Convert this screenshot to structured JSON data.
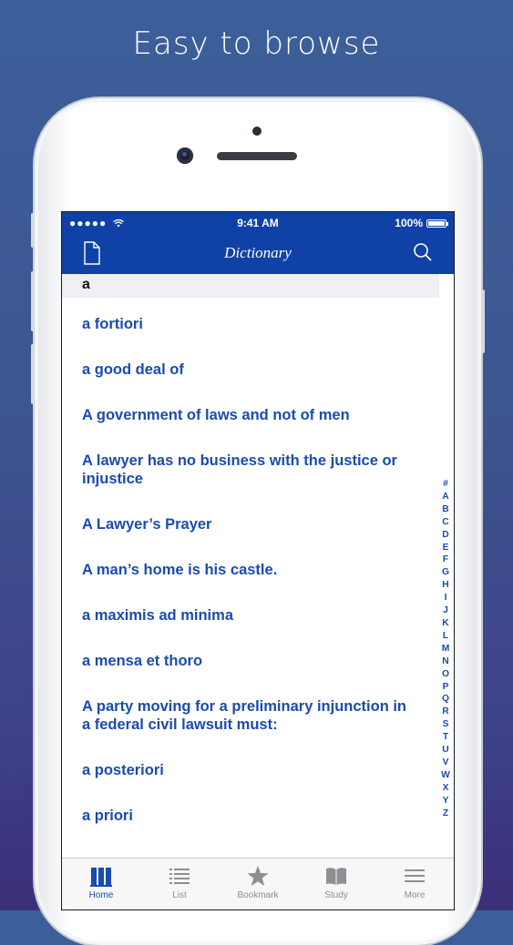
{
  "headline": "Easy to browse",
  "status_bar": {
    "signal": "●●●●●",
    "time": "9:41 AM",
    "battery": "100%"
  },
  "nav": {
    "title": "Dictionary",
    "left_icon": "document-icon",
    "right_icon": "search-icon"
  },
  "section_header": "a",
  "entries": [
    "a fortiori",
    "a good deal of",
    "A government of laws and not of men",
    "A lawyer has no business with the justice or injustice",
    "A Lawyer’s Prayer",
    "A man’s home is his castle.",
    "a maximis ad minima",
    "a mensa et thoro",
    "A party moving for a preliminary injunction in a federal civil lawsuit must:",
    "a posteriori",
    "a priori"
  ],
  "index_letters": [
    "#",
    "A",
    "B",
    "C",
    "D",
    "E",
    "F",
    "G",
    "H",
    "I",
    "J",
    "K",
    "L",
    "M",
    "N",
    "O",
    "P",
    "Q",
    "R",
    "S",
    "T",
    "U",
    "V",
    "W",
    "X",
    "Y",
    "Z"
  ],
  "tabs": [
    {
      "label": "Home",
      "icon": "books-icon",
      "active": true
    },
    {
      "label": "List",
      "icon": "list-icon",
      "active": false
    },
    {
      "label": "Bookmark",
      "icon": "star-icon",
      "active": false
    },
    {
      "label": "Study",
      "icon": "book-icon",
      "active": false
    },
    {
      "label": "More",
      "icon": "menu-icon",
      "active": false
    }
  ],
  "colors": {
    "accent": "#0f41a6",
    "link": "#1a4bb0",
    "tab_inactive": "#8e8e93"
  }
}
